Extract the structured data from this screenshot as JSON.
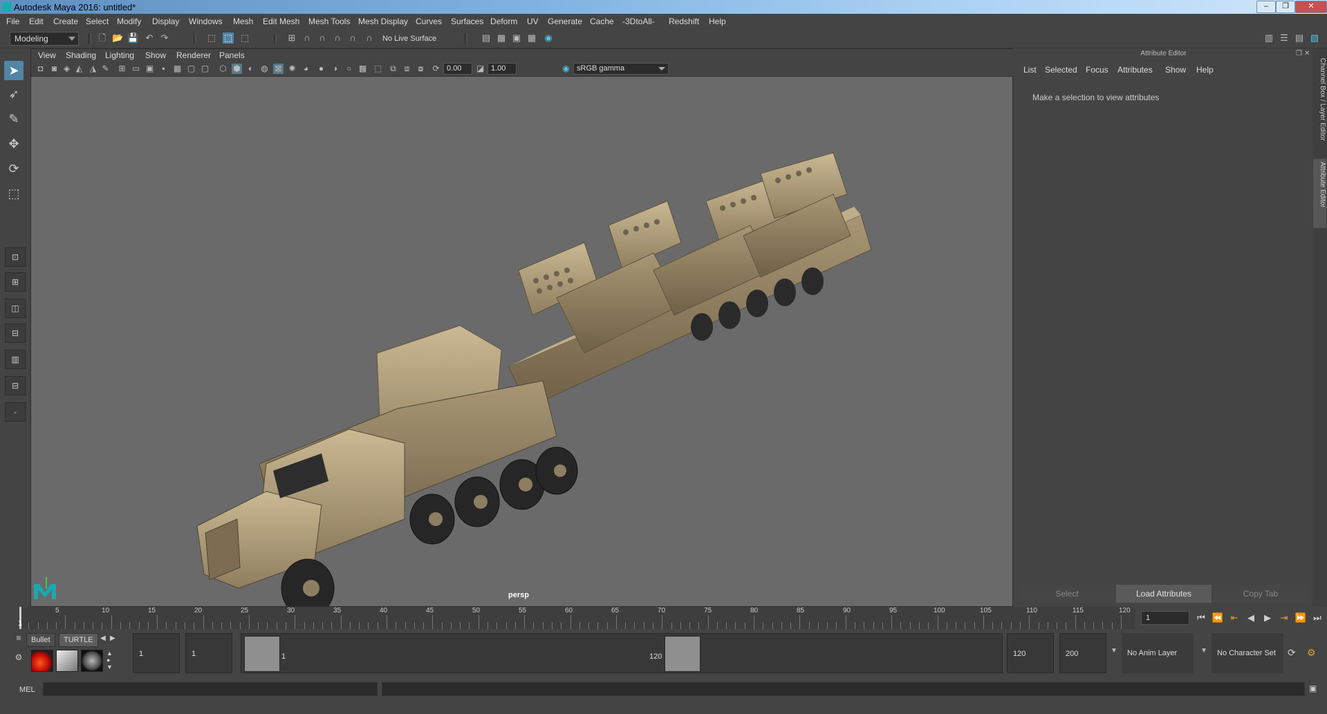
{
  "window": {
    "title": "Autodesk Maya 2016: untitled*"
  },
  "menubar": {
    "items": [
      "File",
      "Edit",
      "Create",
      "Select",
      "Modify",
      "Display",
      "Windows",
      "Mesh",
      "Edit Mesh",
      "Mesh Tools",
      "Mesh Display",
      "Curves",
      "Surfaces",
      "Deform",
      "UV",
      "Generate",
      "Cache",
      "-3DtoAll-",
      "Redshift",
      "Help"
    ]
  },
  "statusline": {
    "mode": "Modeling",
    "live_surface": "No Live Surface"
  },
  "viewport": {
    "menu": [
      "View",
      "Shading",
      "Lighting",
      "Show",
      "Renderer",
      "Panels"
    ],
    "exposure": "0.00",
    "gamma": "1.00",
    "color_space": "sRGB gamma",
    "camera": "persp"
  },
  "attribute_editor": {
    "title": "Attribute Editor",
    "menu": [
      "List",
      "Selected",
      "Focus",
      "Attributes",
      "Show",
      "Help"
    ],
    "message": "Make a selection to view attributes",
    "buttons": {
      "select": "Select",
      "load": "Load Attributes",
      "copy": "Copy Tab"
    }
  },
  "side_tabs": {
    "channel_box": "Channel Box / Layer Editor",
    "attribute_editor": "Attribute Editor"
  },
  "timeline": {
    "ticks": [
      "5",
      "10",
      "15",
      "20",
      "25",
      "30",
      "35",
      "40",
      "45",
      "50",
      "55",
      "60",
      "65",
      "70",
      "75",
      "80",
      "85",
      "90",
      "95",
      "100",
      "105",
      "110",
      "115",
      "120"
    ],
    "current_frame": "1",
    "current_frame_field": "1"
  },
  "shelf": {
    "tabs": [
      "Bullet",
      "TURTLE"
    ]
  },
  "range": {
    "start": "1",
    "playback_start": "1",
    "range_start_label": "1",
    "range_end_label": "120",
    "playback_end": "120",
    "end": "200",
    "anim_layer": "No Anim Layer",
    "character_set": "No Character Set"
  },
  "command_line": {
    "label": "MEL"
  }
}
